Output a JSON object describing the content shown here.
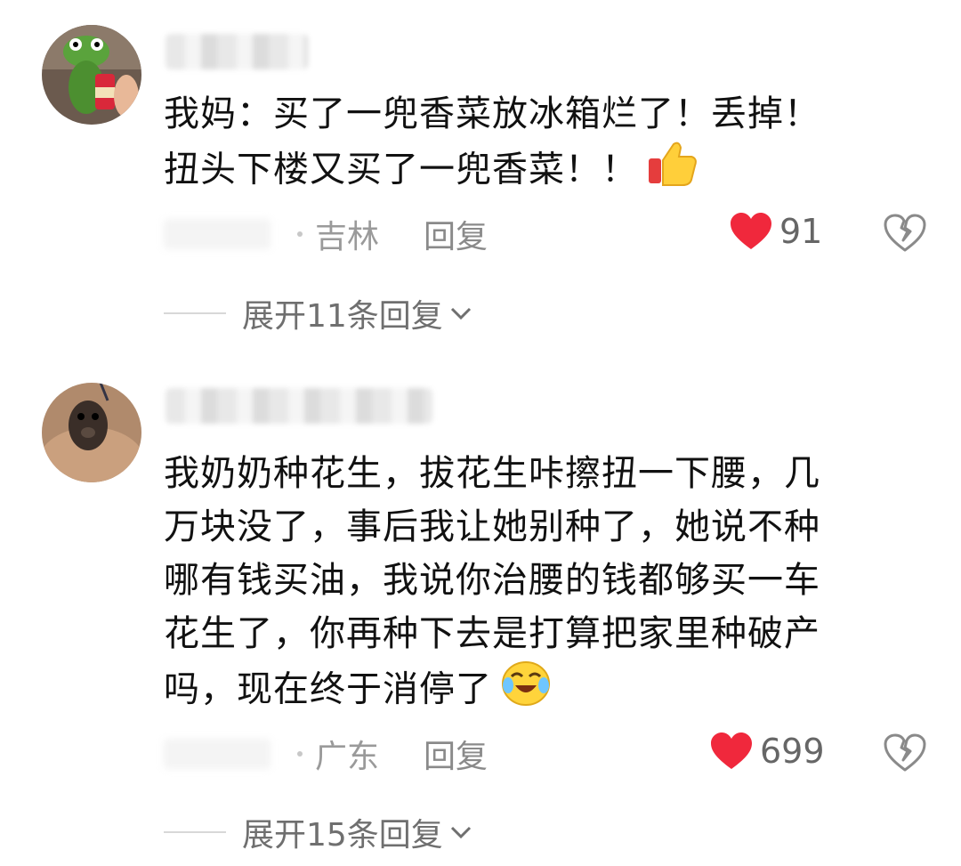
{
  "comments": [
    {
      "lines": [
        "我妈：买了一兜香菜放冰箱烂了！丢掉！",
        "扭头下楼又买了一兜香菜！！"
      ],
      "emoji": "thumbs-up-icon",
      "location": "吉林",
      "reply_label": "回复",
      "likes": "91",
      "expand_label": "展开11条回复"
    },
    {
      "lines": [
        "我奶奶种花生，拔花生咔擦扭一下腰，几",
        "万块没了，事后我让她别种了，她说不种",
        "哪有钱买油，我说你治腰的钱都够买一车",
        "花生了，你再种下去是打算把家里种破产",
        "吗，现在终于消停了"
      ],
      "emoji": "laugh-cry-icon",
      "location": "广东",
      "reply_label": "回复",
      "likes": "699",
      "expand_label": "展开15条回复"
    }
  ],
  "colors": {
    "like_heart": "#f0283c",
    "meta_text": "#9a9a9a",
    "body_text": "#111111"
  }
}
